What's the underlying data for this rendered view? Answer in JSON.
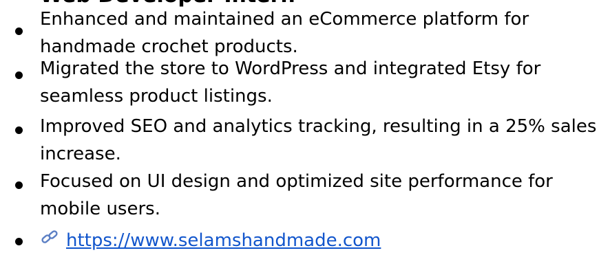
{
  "section": {
    "heading": "Web Developer Intern"
  },
  "bullets": [
    {
      "lines": [
        "Enhanced and maintained an eCommerce platform for",
        "handmade crochet products."
      ]
    },
    {
      "lines": [
        "Migrated the store to WordPress and integrated Etsy for",
        "seamless product listings."
      ]
    },
    {
      "lines": [
        "Improved SEO and analytics tracking, resulting in a 25% sales",
        "increase."
      ]
    },
    {
      "lines": [
        "Focused on UI design and optimized site performance for",
        "mobile users."
      ]
    }
  ],
  "link": {
    "icon": "link-icon",
    "text": "https://www.selamshandmade.com"
  }
}
